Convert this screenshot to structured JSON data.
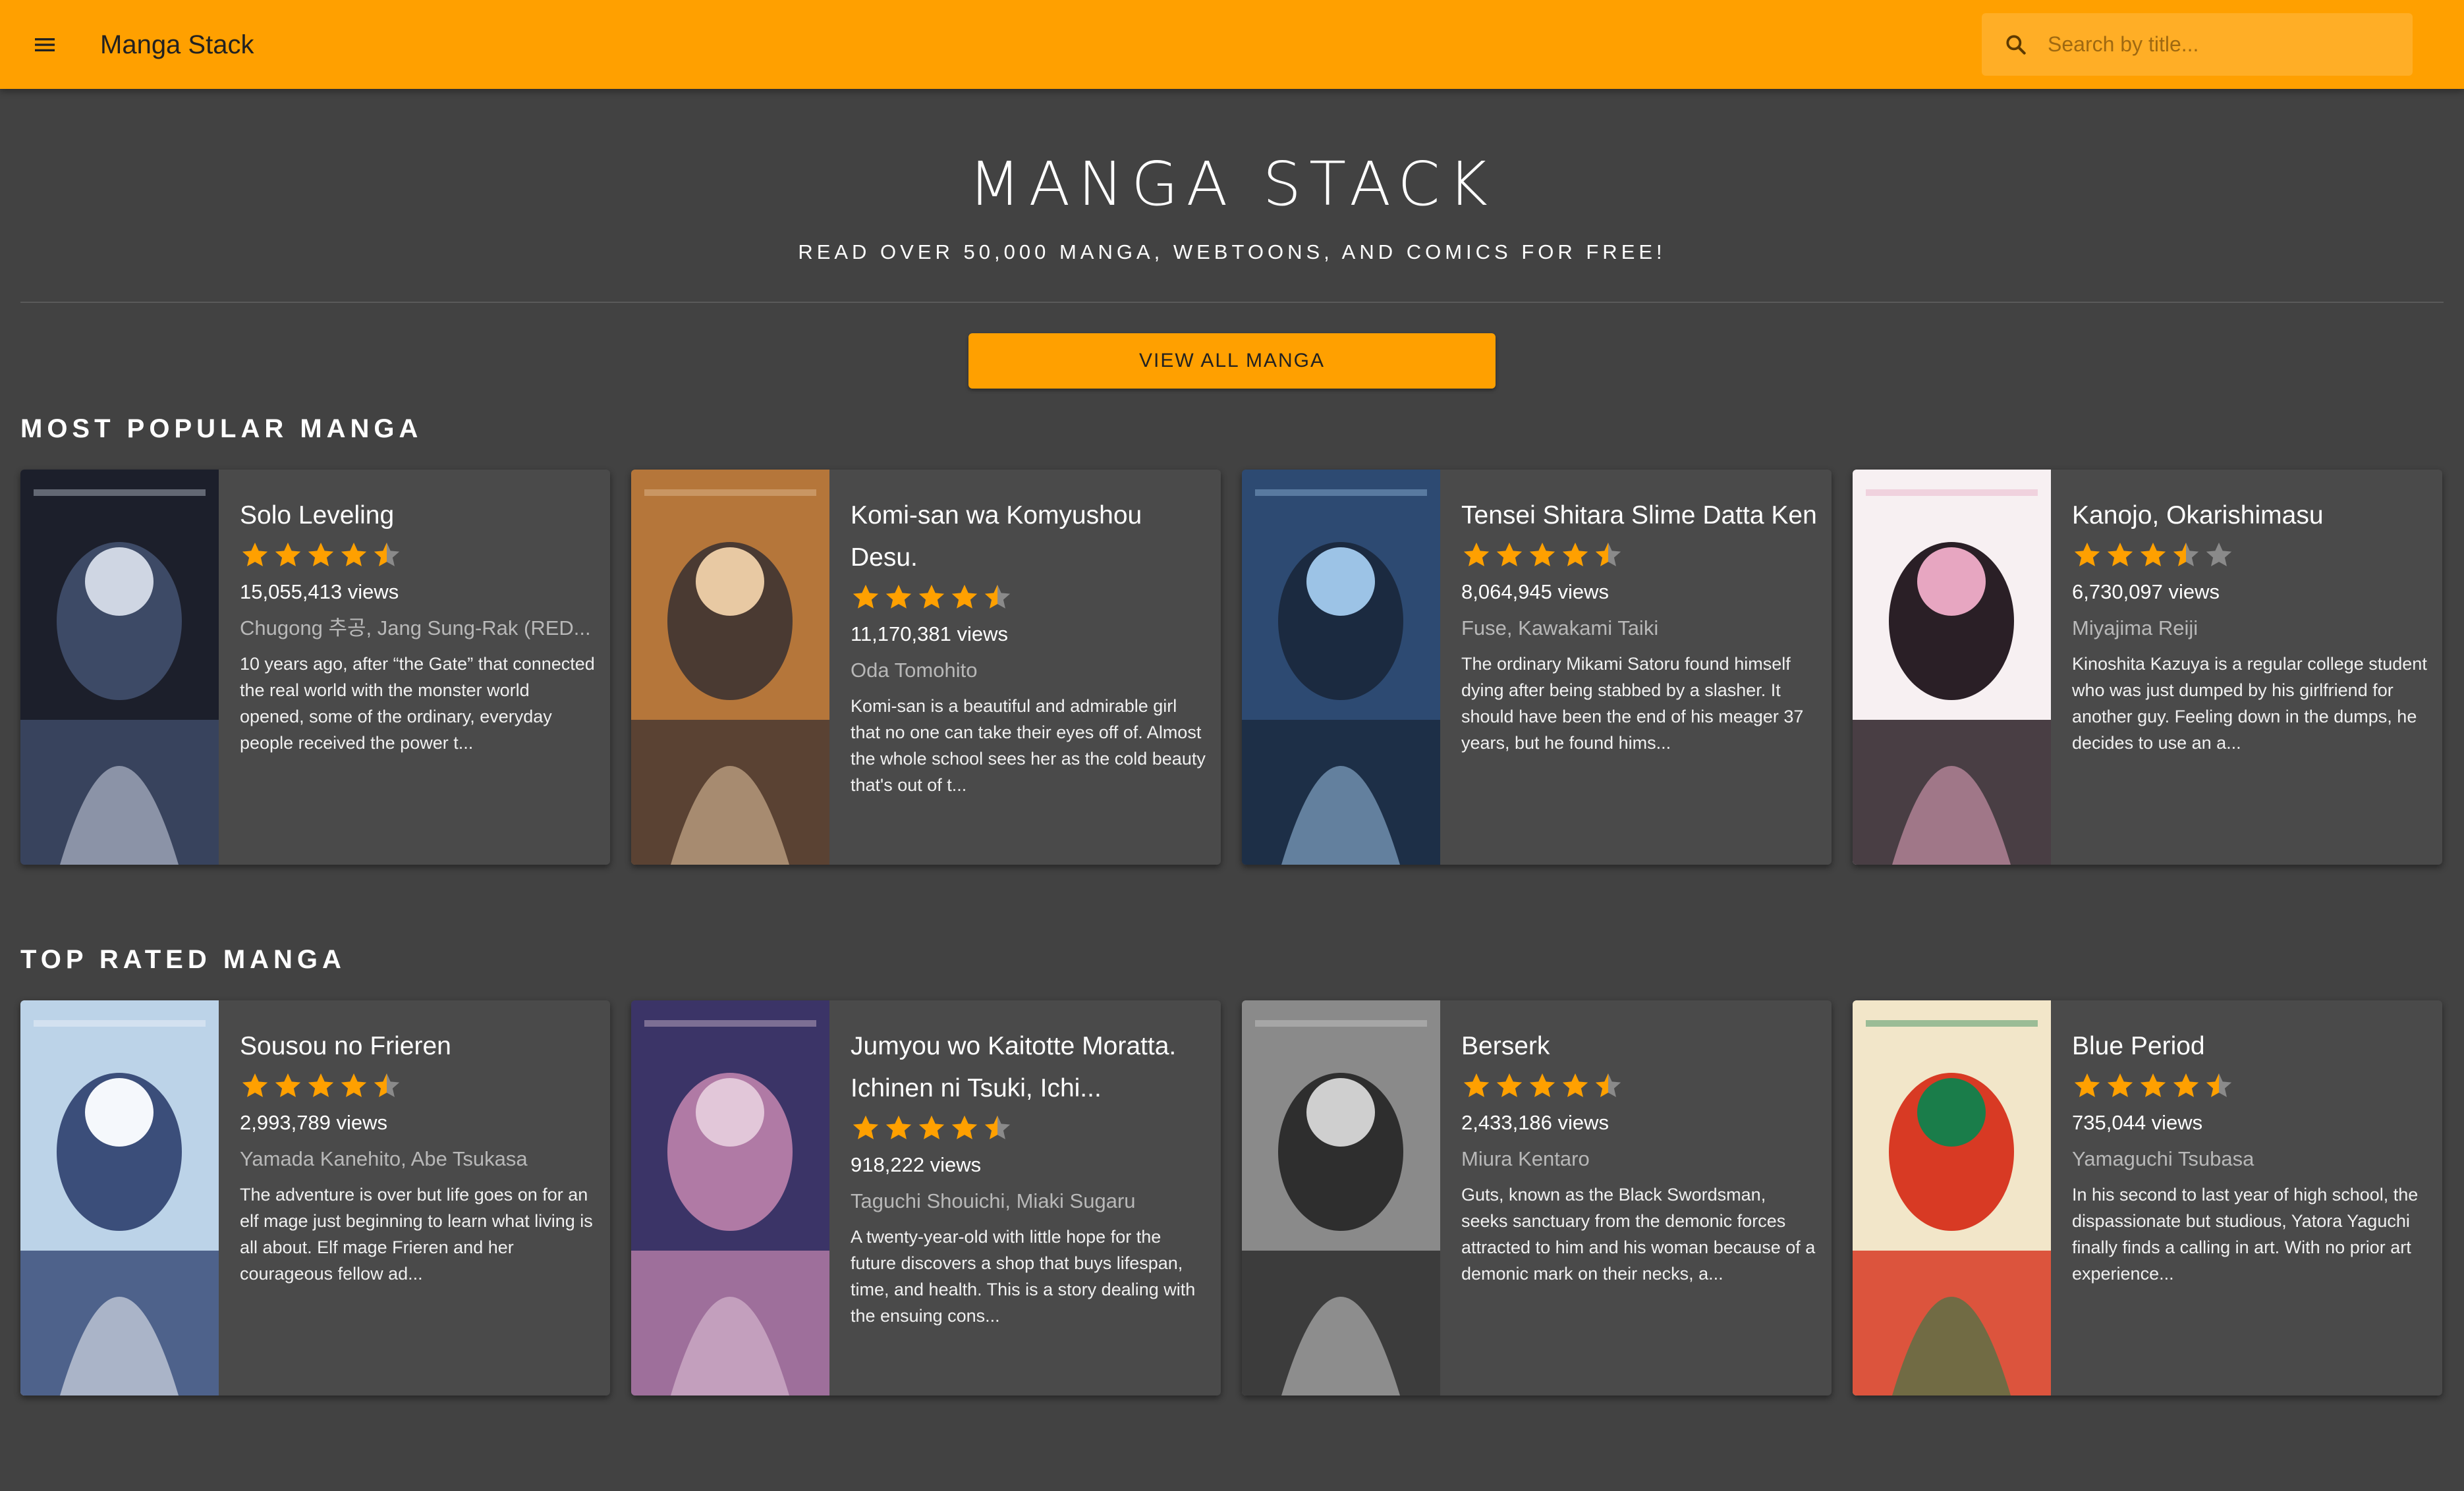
{
  "app": {
    "title": "Manga Stack",
    "accent": "#ffa000",
    "background": "#424242",
    "menu_icon": "hamburger-menu-icon"
  },
  "search": {
    "placeholder": "Search by title...",
    "value": "",
    "icon": "search-icon"
  },
  "hero": {
    "title": "MANGA STACK",
    "subtitle": "READ OVER 50,000 MANGA, WEBTOONS, AND COMICS FOR FREE!",
    "button_label": "VIEW ALL MANGA"
  },
  "sections": [
    {
      "title": "MOST POPULAR MANGA",
      "cards": [
        {
          "title": "Solo Leveling",
          "rating": 4.5,
          "views": "15,055,413 views",
          "authors": "Chugong 추공, Jang Sung-Rak (RED...",
          "description": "10 years ago, after “the Gate” that connected the real world with the monster world opened, some of the ordinary, everyday people received the power t..."
        },
        {
          "title": "Komi-san wa Komyushou Desu.",
          "rating": 4.5,
          "views": "11,170,381 views",
          "authors": "Oda Tomohito",
          "description": "Komi-san is a beautiful and admirable girl that no one can take their eyes off of. Almost the whole school sees her as the cold beauty that's out of t..."
        },
        {
          "title": "Tensei Shitara Slime Datta Ken",
          "rating": 4.5,
          "views": "8,064,945 views",
          "authors": "Fuse, Kawakami Taiki",
          "description": "The ordinary Mikami Satoru found himself dying after being stabbed by a slasher. It should have been the end of his meager 37 years, but he found hims..."
        },
        {
          "title": "Kanojo, Okarishimasu",
          "rating": 3.5,
          "views": "6,730,097 views",
          "authors": "Miyajima Reiji",
          "description": "Kinoshita Kazuya is a regular college student who was just dumped by his girlfriend for another guy. Feeling down in the dumps, he decides to use an a..."
        }
      ]
    },
    {
      "title": "TOP RATED MANGA",
      "cards": [
        {
          "title": "Sousou no Frieren",
          "rating": 4.5,
          "views": "2,993,789 views",
          "authors": "Yamada Kanehito, Abe Tsukasa",
          "description": "The adventure is over but life goes on for an elf mage just beginning to learn what living is all about. Elf mage Frieren and her courageous fellow ad..."
        },
        {
          "title": "Jumyou wo Kaitotte Moratta. Ichinen ni Tsuki, Ichi...",
          "rating": 4.5,
          "views": "918,222 views",
          "authors": "Taguchi Shouichi, Miaki Sugaru",
          "description": "A twenty-year-old with little hope for the future discovers a shop that buys lifespan, time, and health. This is a story dealing with the ensuing cons..."
        },
        {
          "title": "Berserk",
          "rating": 4.5,
          "views": "2,433,186 views",
          "authors": "Miura Kentaro",
          "description": "Guts, known as the Black Swordsman, seeks sanctuary from the demonic forces attracted to him and his woman because of a demonic mark on their necks, a..."
        },
        {
          "title": "Blue Period",
          "rating": 4.5,
          "views": "735,044 views",
          "authors": "Yamaguchi Tsubasa",
          "description": "In his second to last year of high school, the dispassionate but studious, Yatora Yaguchi finally finds a calling in art. With no prior art experience..."
        }
      ]
    }
  ]
}
